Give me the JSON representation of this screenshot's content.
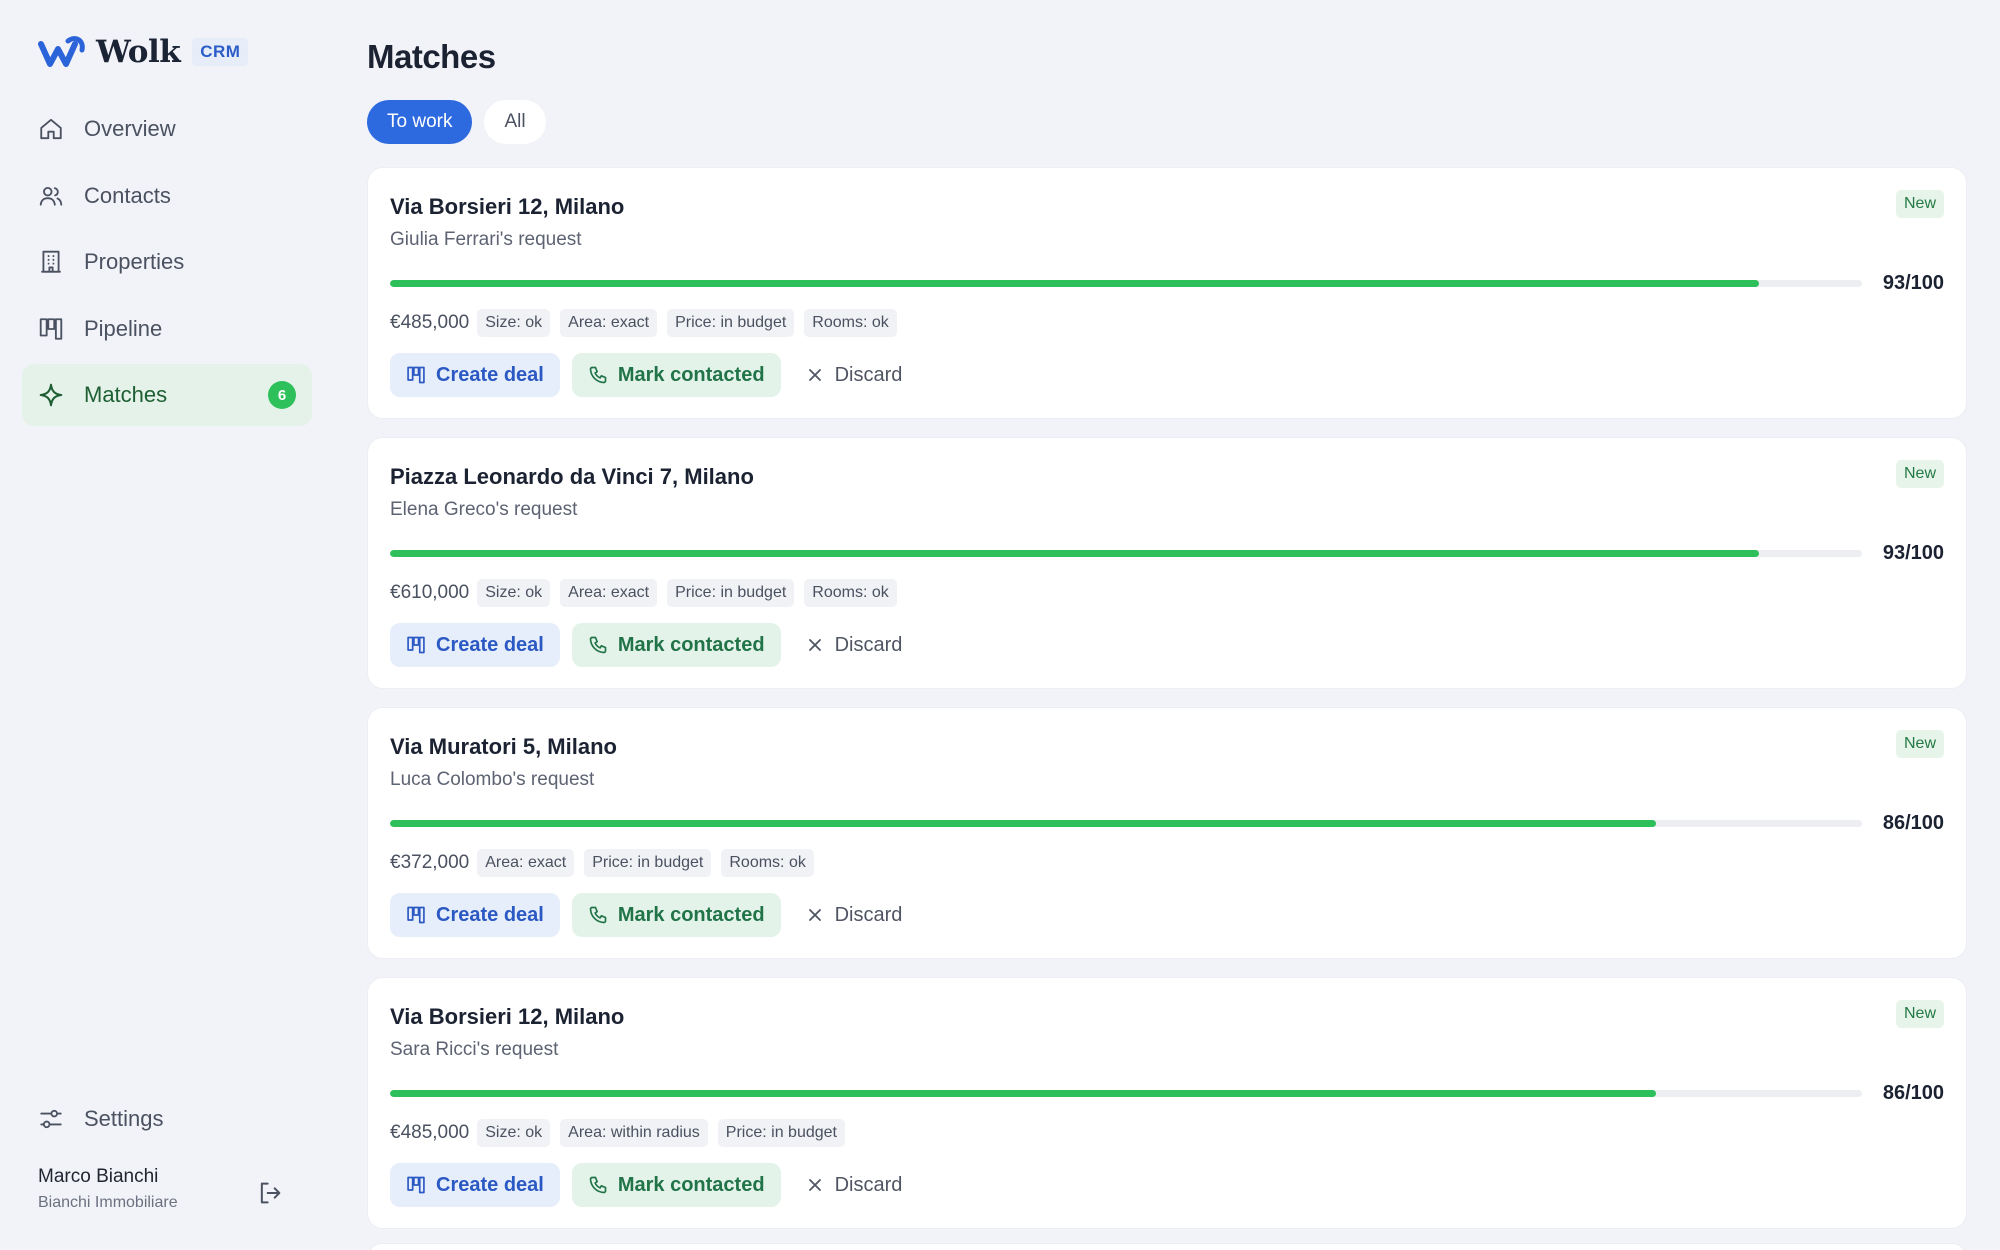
{
  "brand": {
    "name": "Wolk",
    "tag": "CRM"
  },
  "nav": {
    "items": [
      {
        "label": "Overview",
        "icon": "home-icon"
      },
      {
        "label": "Contacts",
        "icon": "users-icon"
      },
      {
        "label": "Properties",
        "icon": "building-icon"
      },
      {
        "label": "Pipeline",
        "icon": "kanban-icon"
      },
      {
        "label": "Matches",
        "icon": "sparkle-icon",
        "badge": "6",
        "active": true
      }
    ],
    "settings": "Settings"
  },
  "user": {
    "name": "Marco Bianchi",
    "company": "Bianchi Immobiliare"
  },
  "main": {
    "title": "Matches",
    "filters": [
      "To work",
      "All"
    ],
    "active_filter": "To work"
  },
  "cards": [
    {
      "title": "Via Borsieri 12, Milano",
      "subtitle": "Giulia Ferrari's request",
      "status": "New",
      "score": "93/100",
      "score_fraction": 0.93,
      "price": "€485,000",
      "tags": [
        "Size: ok",
        "Area: exact",
        "Price: in budget",
        "Rooms: ok"
      ]
    },
    {
      "title": "Piazza Leonardo da Vinci 7, Milano",
      "subtitle": "Elena Greco's request",
      "status": "New",
      "score": "93/100",
      "score_fraction": 0.93,
      "price": "€610,000",
      "tags": [
        "Size: ok",
        "Area: exact",
        "Price: in budget",
        "Rooms: ok"
      ]
    },
    {
      "title": "Via Muratori 5, Milano",
      "subtitle": "Luca Colombo's request",
      "status": "New",
      "score": "86/100",
      "score_fraction": 0.86,
      "price": "€372,000",
      "tags": [
        "Area: exact",
        "Price: in budget",
        "Rooms: ok"
      ]
    },
    {
      "title": "Via Borsieri 12, Milano",
      "subtitle": "Sara Ricci's request",
      "status": "New",
      "score": "86/100",
      "score_fraction": 0.86,
      "price": "€485,000",
      "tags": [
        "Size: ok",
        "Area: within radius",
        "Price: in budget"
      ]
    }
  ],
  "actions": {
    "create_deal": "Create deal",
    "mark_contacted": "Mark contacted",
    "discard": "Discard"
  },
  "colors": {
    "accent_blue": "#2d6ae0",
    "match_green": "#2cbf5a",
    "active_nav_bg": "#e5f2e9"
  }
}
